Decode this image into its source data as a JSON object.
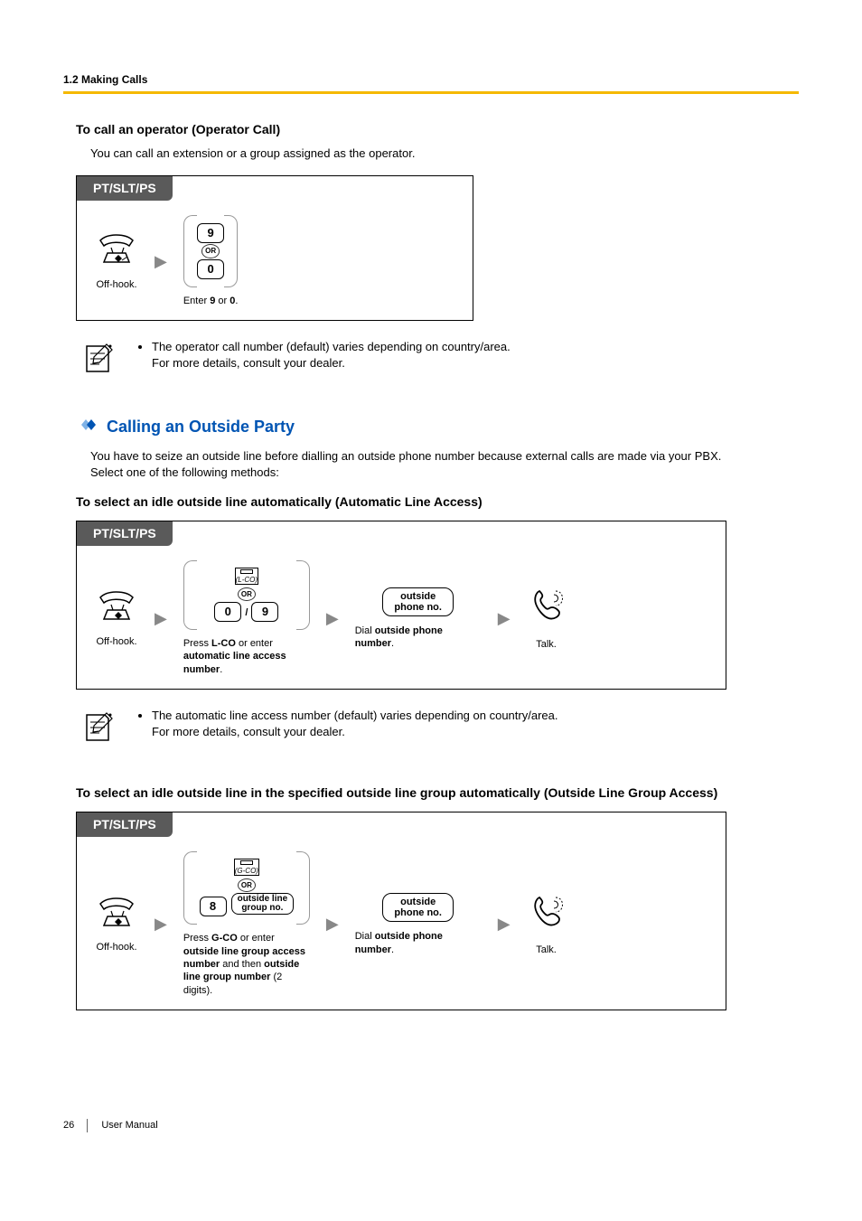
{
  "header": {
    "section": "1.2 Making Calls"
  },
  "operator": {
    "title": "To call an operator (Operator Call)",
    "intro": "You can call an extension or a group assigned as the operator.",
    "box_label": "PT/SLT/PS",
    "step1_caption": "Off-hook.",
    "key_top": "9",
    "or_label": "OR",
    "key_bottom": "0",
    "step2_prefix": "Enter ",
    "step2_bold1": "9",
    "step2_mid": " or ",
    "step2_bold2": "0",
    "step2_suffix": ".",
    "note_line1": "The operator call number (default) varies depending on country/area.",
    "note_line2": "For more details, consult your dealer."
  },
  "outside": {
    "heading": "Calling an Outside Party",
    "intro1": "You have to seize an outside line before dialling an outside phone number because external calls are made via your PBX.",
    "intro2": "Select one of the following methods:"
  },
  "auto": {
    "title": "To select an idle outside line automatically (Automatic Line Access)",
    "box_label": "PT/SLT/PS",
    "step1_caption": "Off-hook.",
    "lco_label": "(L-CO)",
    "or_label": "OR",
    "key_left": "0",
    "slash": "/",
    "key_right": "9",
    "step2_p1": "Press ",
    "step2_b1": "L-CO",
    "step2_p2": " or enter ",
    "step2_b2": "automatic line access number",
    "step2_p3": ".",
    "pill_line1": "outside",
    "pill_line2": "phone no.",
    "step3_p1": "Dial ",
    "step3_b1": "outside phone number",
    "step3_p2": ".",
    "step4": "Talk.",
    "note_line1": "The automatic line access number (default) varies depending on country/area.",
    "note_line2": "For more details, consult your dealer."
  },
  "group": {
    "title": "To select an idle outside line in the specified outside line group automatically (Outside Line Group Access)",
    "box_label": "PT/SLT/PS",
    "step1_caption": "Off-hook.",
    "gco_label": "(G-CO)",
    "or_label": "OR",
    "key_eight": "8",
    "pill2_line1": "outside line",
    "pill2_line2": "group no.",
    "step2_p1": "Press ",
    "step2_b1": "G-CO",
    "step2_p2": " or enter ",
    "step2_b2": "outside line group access number",
    "step2_p3": " and then ",
    "step2_b3": "outside line group number",
    "step2_p4": " (2 digits).",
    "pill_line1": "outside",
    "pill_line2": "phone no.",
    "step3_p1": "Dial ",
    "step3_b1": "outside phone number",
    "step3_p2": ".",
    "step4": "Talk."
  },
  "footer": {
    "page": "26",
    "manual": "User Manual"
  }
}
